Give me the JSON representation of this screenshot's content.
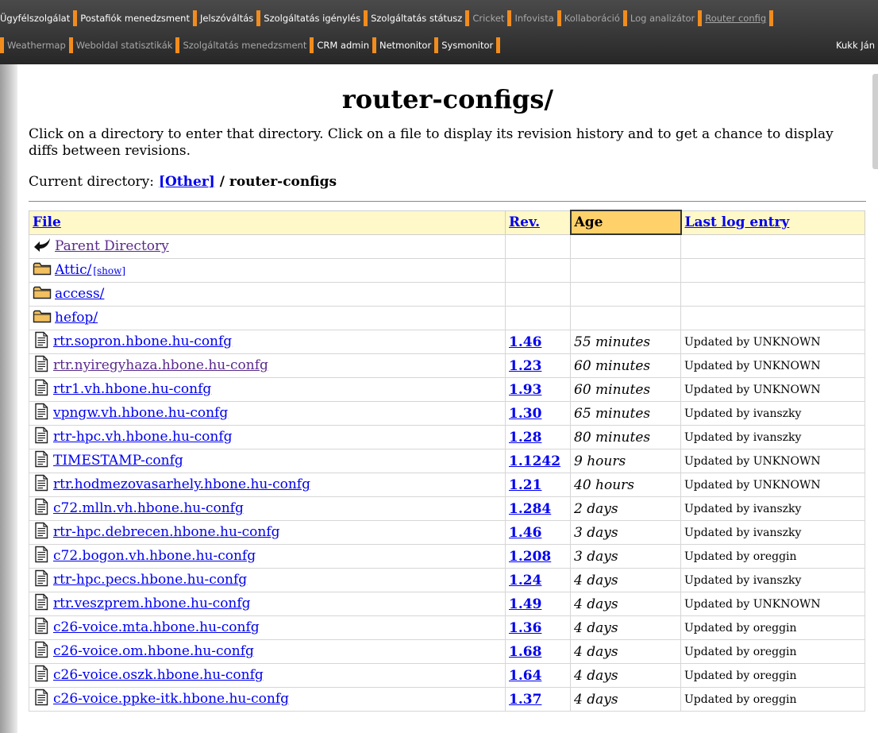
{
  "nav": {
    "row1": [
      {
        "label": "Ügyfélszolgálat",
        "state": "normal"
      },
      {
        "label": "Postafiók menedzsment",
        "state": "normal"
      },
      {
        "label": "Jelszóváltás",
        "state": "normal"
      },
      {
        "label": "Szolgáltatás igénylés",
        "state": "normal"
      },
      {
        "label": "Szolgáltatás státusz",
        "state": "normal"
      },
      {
        "label": "Cricket",
        "state": "muted"
      },
      {
        "label": "Infovista",
        "state": "muted"
      },
      {
        "label": "Kollaboráció",
        "state": "muted"
      },
      {
        "label": "Log analizátor",
        "state": "muted"
      },
      {
        "label": "Router config",
        "state": "active"
      }
    ],
    "row2": [
      {
        "label": "Weathermap",
        "state": "muted"
      },
      {
        "label": "Weboldal statisztikák",
        "state": "muted"
      },
      {
        "label": "Szolgáltatás menedzsment",
        "state": "muted"
      },
      {
        "label": "CRM admin",
        "state": "normal"
      },
      {
        "label": "Netmonitor",
        "state": "normal"
      },
      {
        "label": "Sysmonitor",
        "state": "normal"
      }
    ],
    "user": "Kukk Ján",
    "colors": {
      "separator": "#f28c1c",
      "bar": "#2e2e2e"
    }
  },
  "page": {
    "title": "router-configs/",
    "instructions": "Click on a directory to enter that directory. Click on a file to display its revision history and to get a chance to display diffs between revisions.",
    "current_dir_label": "Current directory:",
    "current_dir_root": "[Other]",
    "current_dir_sep": " / ",
    "current_dir_name": "router-configs"
  },
  "table": {
    "headers": {
      "file": "File",
      "rev": "Rev.",
      "age": "Age",
      "log": "Last log entry"
    },
    "sorted_by": "Age",
    "show_label": "[show]",
    "rows": [
      {
        "kind": "parent",
        "name": "Parent Directory",
        "rev": "",
        "age": "",
        "log": "",
        "visited": true
      },
      {
        "kind": "dir",
        "name": "Attic/",
        "rev": "",
        "age": "",
        "log": "",
        "show": true
      },
      {
        "kind": "dir",
        "name": "access/",
        "rev": "",
        "age": "",
        "log": ""
      },
      {
        "kind": "dir",
        "name": "hefop/",
        "rev": "",
        "age": "",
        "log": ""
      },
      {
        "kind": "file",
        "name": "rtr.sopron.hbone.hu-confg",
        "rev": "1.46",
        "age": "55 minutes",
        "log": "Updated by UNKNOWN"
      },
      {
        "kind": "file",
        "name": "rtr.nyiregyhaza.hbone.hu-confg",
        "rev": "1.23",
        "age": "60 minutes",
        "log": "Updated by UNKNOWN",
        "visited": true
      },
      {
        "kind": "file",
        "name": "rtr1.vh.hbone.hu-confg",
        "rev": "1.93",
        "age": "60 minutes",
        "log": "Updated by UNKNOWN"
      },
      {
        "kind": "file",
        "name": "vpngw.vh.hbone.hu-confg",
        "rev": "1.30",
        "age": "65 minutes",
        "log": "Updated by ivanszky"
      },
      {
        "kind": "file",
        "name": "rtr-hpc.vh.hbone.hu-confg",
        "rev": "1.28",
        "age": "80 minutes",
        "log": "Updated by ivanszky"
      },
      {
        "kind": "file",
        "name": "TIMESTAMP-confg",
        "rev": "1.1242",
        "age": "9 hours",
        "log": "Updated by UNKNOWN"
      },
      {
        "kind": "file",
        "name": "rtr.hodmezovasarhely.hbone.hu-confg",
        "rev": "1.21",
        "age": "40 hours",
        "log": "Updated by UNKNOWN"
      },
      {
        "kind": "file",
        "name": "c72.mlln.vh.hbone.hu-confg",
        "rev": "1.284",
        "age": "2 days",
        "log": "Updated by ivanszky"
      },
      {
        "kind": "file",
        "name": "rtr-hpc.debrecen.hbone.hu-confg",
        "rev": "1.46",
        "age": "3 days",
        "log": "Updated by ivanszky"
      },
      {
        "kind": "file",
        "name": "c72.bogon.vh.hbone.hu-confg",
        "rev": "1.208",
        "age": "3 days",
        "log": "Updated by oreggin"
      },
      {
        "kind": "file",
        "name": "rtr-hpc.pecs.hbone.hu-confg",
        "rev": "1.24",
        "age": "4 days",
        "log": "Updated by ivanszky"
      },
      {
        "kind": "file",
        "name": "rtr.veszprem.hbone.hu-confg",
        "rev": "1.49",
        "age": "4 days",
        "log": "Updated by UNKNOWN"
      },
      {
        "kind": "file",
        "name": "c26-voice.mta.hbone.hu-confg",
        "rev": "1.36",
        "age": "4 days",
        "log": "Updated by oreggin"
      },
      {
        "kind": "file",
        "name": "c26-voice.om.hbone.hu-confg",
        "rev": "1.68",
        "age": "4 days",
        "log": "Updated by oreggin"
      },
      {
        "kind": "file",
        "name": "c26-voice.oszk.hbone.hu-confg",
        "rev": "1.64",
        "age": "4 days",
        "log": "Updated by oreggin"
      },
      {
        "kind": "file",
        "name": "c26-voice.ppke-itk.hbone.hu-confg",
        "rev": "1.37",
        "age": "4 days",
        "log": "Updated by oreggin"
      }
    ]
  }
}
